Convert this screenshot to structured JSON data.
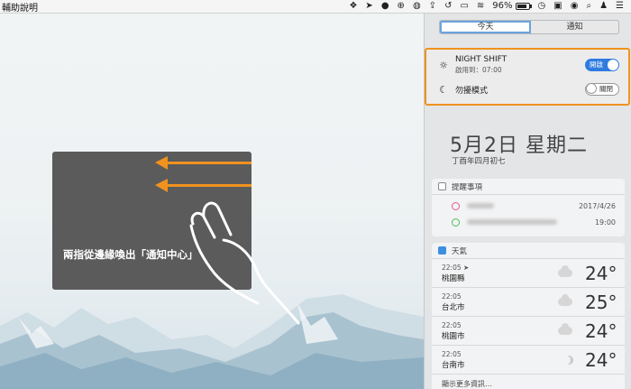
{
  "menubar": {
    "app_menu_item": "輔助說明",
    "battery_percent": "96%",
    "icons": [
      "dropbox-icon",
      "location-icon",
      "line-icon",
      "globe-icon",
      "wechat-icon",
      "upload-icon",
      "time-machine-icon",
      "airplay-icon",
      "wifi-icon",
      "battery-icon",
      "clock-icon",
      "input-method-icon",
      "siri-icon",
      "spotlight-icon",
      "user-icon",
      "notification-center-icon"
    ]
  },
  "tutorial": {
    "caption": "兩指從邊緣喚出「通知中心」",
    "accent_color": "#f0921e"
  },
  "notification_center": {
    "tabs": [
      {
        "label": "今天",
        "active": true
      },
      {
        "label": "通知",
        "active": false
      }
    ],
    "night_shift": {
      "title": "NIGHT SHIFT",
      "subtitle": "啟用到：07:00",
      "switch_label": "開啟",
      "on": true
    },
    "do_not_disturb": {
      "title": "勿擾模式",
      "switch_label": "關閉",
      "on": false
    },
    "date_big": "5月2日 星期二",
    "date_lunar": "丁酉年四月初七",
    "reminders": {
      "title": "提醒事項",
      "items": [
        {
          "color": "#e75a8a",
          "when": "2017/4/26"
        },
        {
          "color": "#4dbe5b",
          "when": "19:00"
        }
      ]
    },
    "weather": {
      "title": "天氣",
      "rows": [
        {
          "time": "22:05",
          "city": "桃園縣",
          "temp": "24°",
          "icon": "cloud-icon"
        },
        {
          "time": "22:05",
          "city": "台北市",
          "temp": "25°",
          "icon": "cloud-icon"
        },
        {
          "time": "22:05",
          "city": "桃園市",
          "temp": "24°",
          "icon": "cloud-icon"
        },
        {
          "time": "22:05",
          "city": "台南市",
          "temp": "24°",
          "icon": "moon-icon"
        }
      ],
      "more": "顯示更多資訊…"
    }
  }
}
